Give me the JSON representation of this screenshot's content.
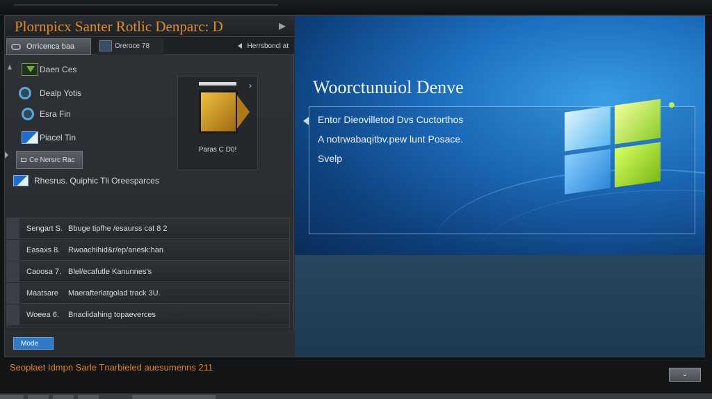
{
  "window": {
    "title": "Plornpicx Santer Rotlic Denparc: D"
  },
  "tabs": {
    "tab1_label": "Orricenca baa",
    "tab2_label": "Oreroce 78",
    "right_label": "Herrsboncl at"
  },
  "nav": {
    "items": [
      {
        "label": "Daen Ces",
        "icon": "download-icon"
      },
      {
        "label": "Dealp Yotis",
        "icon": "magnifier-icon"
      },
      {
        "label": "Esra Fin",
        "icon": "magnifier-icon"
      },
      {
        "label": "Piacel Tin",
        "icon": "window-icon"
      }
    ]
  },
  "small_button": {
    "label": "Ce Nersrc Rac"
  },
  "thumbnail": {
    "caption": "Paras C D0!"
  },
  "option_row": {
    "label": "Rhesrus. Quiphic Tli Oreesparces"
  },
  "list": {
    "rows": [
      {
        "c1": "Sengart S.",
        "c2": "Bbuge tipfhe /esaurss cat 8 2"
      },
      {
        "c1": "Easaxs 8.",
        "c2": "Rwoachihid&r/ep/anesk:han"
      },
      {
        "c1": "Caoosa 7.",
        "c2": "Blel/ecafutle Kanunnes's"
      },
      {
        "c1": "Maatsare",
        "c2": "Maerafterlatgolad track 3U."
      },
      {
        "c1": "Woeea 6.",
        "c2": "Bnaclidahing topaeverces"
      }
    ]
  },
  "mode_button": {
    "label": "Mode"
  },
  "hero": {
    "title": "Woorctunuiol Denve",
    "lines": [
      "Entor Dieovilletod Dvs Cuctorthos",
      "A notrwabaqitbv.pew lunt Posace.",
      "Svelp"
    ]
  },
  "status": {
    "text": "Seoplaet Idmpn Sarle Tnarbieled auesumenns 211"
  },
  "dropdown": {
    "label": "⌄"
  },
  "colors": {
    "accent_orange": "#e28a2a",
    "accent_blue": "#2f79c8",
    "hero_blue": "#1d6fc0"
  }
}
